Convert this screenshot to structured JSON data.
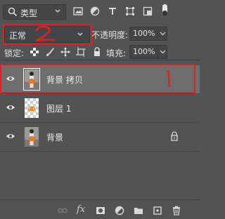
{
  "filter": {
    "kind_label": "类型",
    "icons": [
      "image-filter-icon",
      "adjustment-filter-icon",
      "type-filter-icon",
      "shape-filter-icon",
      "smart-object-filter-icon"
    ]
  },
  "blend": {
    "mode": "正常",
    "opacity_label": "不透明度:",
    "opacity_value": "100%"
  },
  "lock": {
    "label": "锁定:",
    "fill_label": "填充:",
    "fill_value": "100%"
  },
  "layers": [
    {
      "name": "背景 拷贝",
      "selected": true,
      "thumb": "photo"
    },
    {
      "name": "图层 1",
      "selected": false,
      "thumb": "transparent"
    },
    {
      "name": "背景",
      "selected": false,
      "thumb": "photo",
      "locked": true
    }
  ],
  "annotations": [
    "2",
    "1"
  ],
  "colors": {
    "panel": "#535353",
    "selected_row": "#6e6e6e",
    "annotation": "#e02020"
  }
}
